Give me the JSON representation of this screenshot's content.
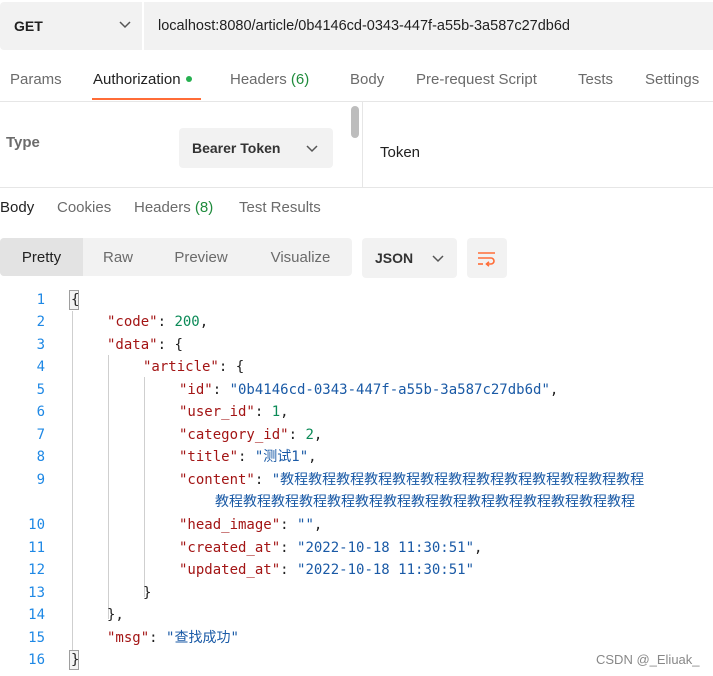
{
  "request": {
    "method": "GET",
    "url": "localhost:8080/article/0b4146cd-0343-447f-a55b-3a587c27db6d"
  },
  "request_tabs": {
    "params": "Params",
    "authorization": "Authorization",
    "headers": "Headers",
    "headers_count": "(6)",
    "body": "Body",
    "prerequest": "Pre-request Script",
    "tests": "Tests",
    "settings": "Settings"
  },
  "auth": {
    "type_label": "Type",
    "type_value": "Bearer Token",
    "token_label": "Token"
  },
  "response_tabs": {
    "body": "Body",
    "cookies": "Cookies",
    "headers": "Headers",
    "headers_count": "(8)",
    "test_results": "Test Results"
  },
  "view": {
    "pretty": "Pretty",
    "raw": "Raw",
    "preview": "Preview",
    "visualize": "Visualize",
    "format": "JSON"
  },
  "code": {
    "line_numbers": [
      "1",
      "2",
      "3",
      "4",
      "5",
      "6",
      "7",
      "8",
      "9",
      "10",
      "11",
      "12",
      "13",
      "14",
      "15",
      "16"
    ],
    "open_brace": "{",
    "close_brace": "}",
    "close_brace_comma": "},",
    "colon": ": ",
    "comma": ",",
    "code_key": "\"code\"",
    "code_val": "200",
    "data_key": "\"data\"",
    "article_key": "\"article\"",
    "id_key": "\"id\"",
    "id_val": "\"0b4146cd-0343-447f-a55b-3a587c27db6d\"",
    "user_id_key": "\"user_id\"",
    "user_id_val": "1",
    "category_id_key": "\"category_id\"",
    "category_id_val": "2",
    "title_key": "\"title\"",
    "title_val": "\"测试1\"",
    "content_key": "\"content\"",
    "content_val_line1": "\"教程教程教程教程教程教程教程教程教程教程教程教程教程",
    "content_val_line2": "教程教程教程教程教程教程教程教程教程教程教程教程教程教程教程",
    "head_image_key": "\"head_image\"",
    "head_image_val": "\"\"",
    "created_at_key": "\"created_at\"",
    "created_at_val": "\"2022-10-18 11:30:51\"",
    "updated_at_key": "\"updated_at\"",
    "updated_at_val": "\"2022-10-18 11:30:51\"",
    "msg_key": "\"msg\"",
    "msg_val": "\"查找成功\""
  },
  "watermark": "CSDN @_Eliuak_",
  "colors": {
    "accent": "#ff6c37",
    "active_dot": "#26b050",
    "json_key": "#a31515",
    "json_string": "#1a5aa6",
    "json_number": "#0b8a57",
    "line_number": "#1e88e5"
  },
  "icons": {
    "method_dropdown": "chevron-down-icon",
    "auth_dropdown": "chevron-down-icon",
    "format_dropdown": "chevron-down-icon",
    "wrap": "wrap-lines-icon"
  }
}
